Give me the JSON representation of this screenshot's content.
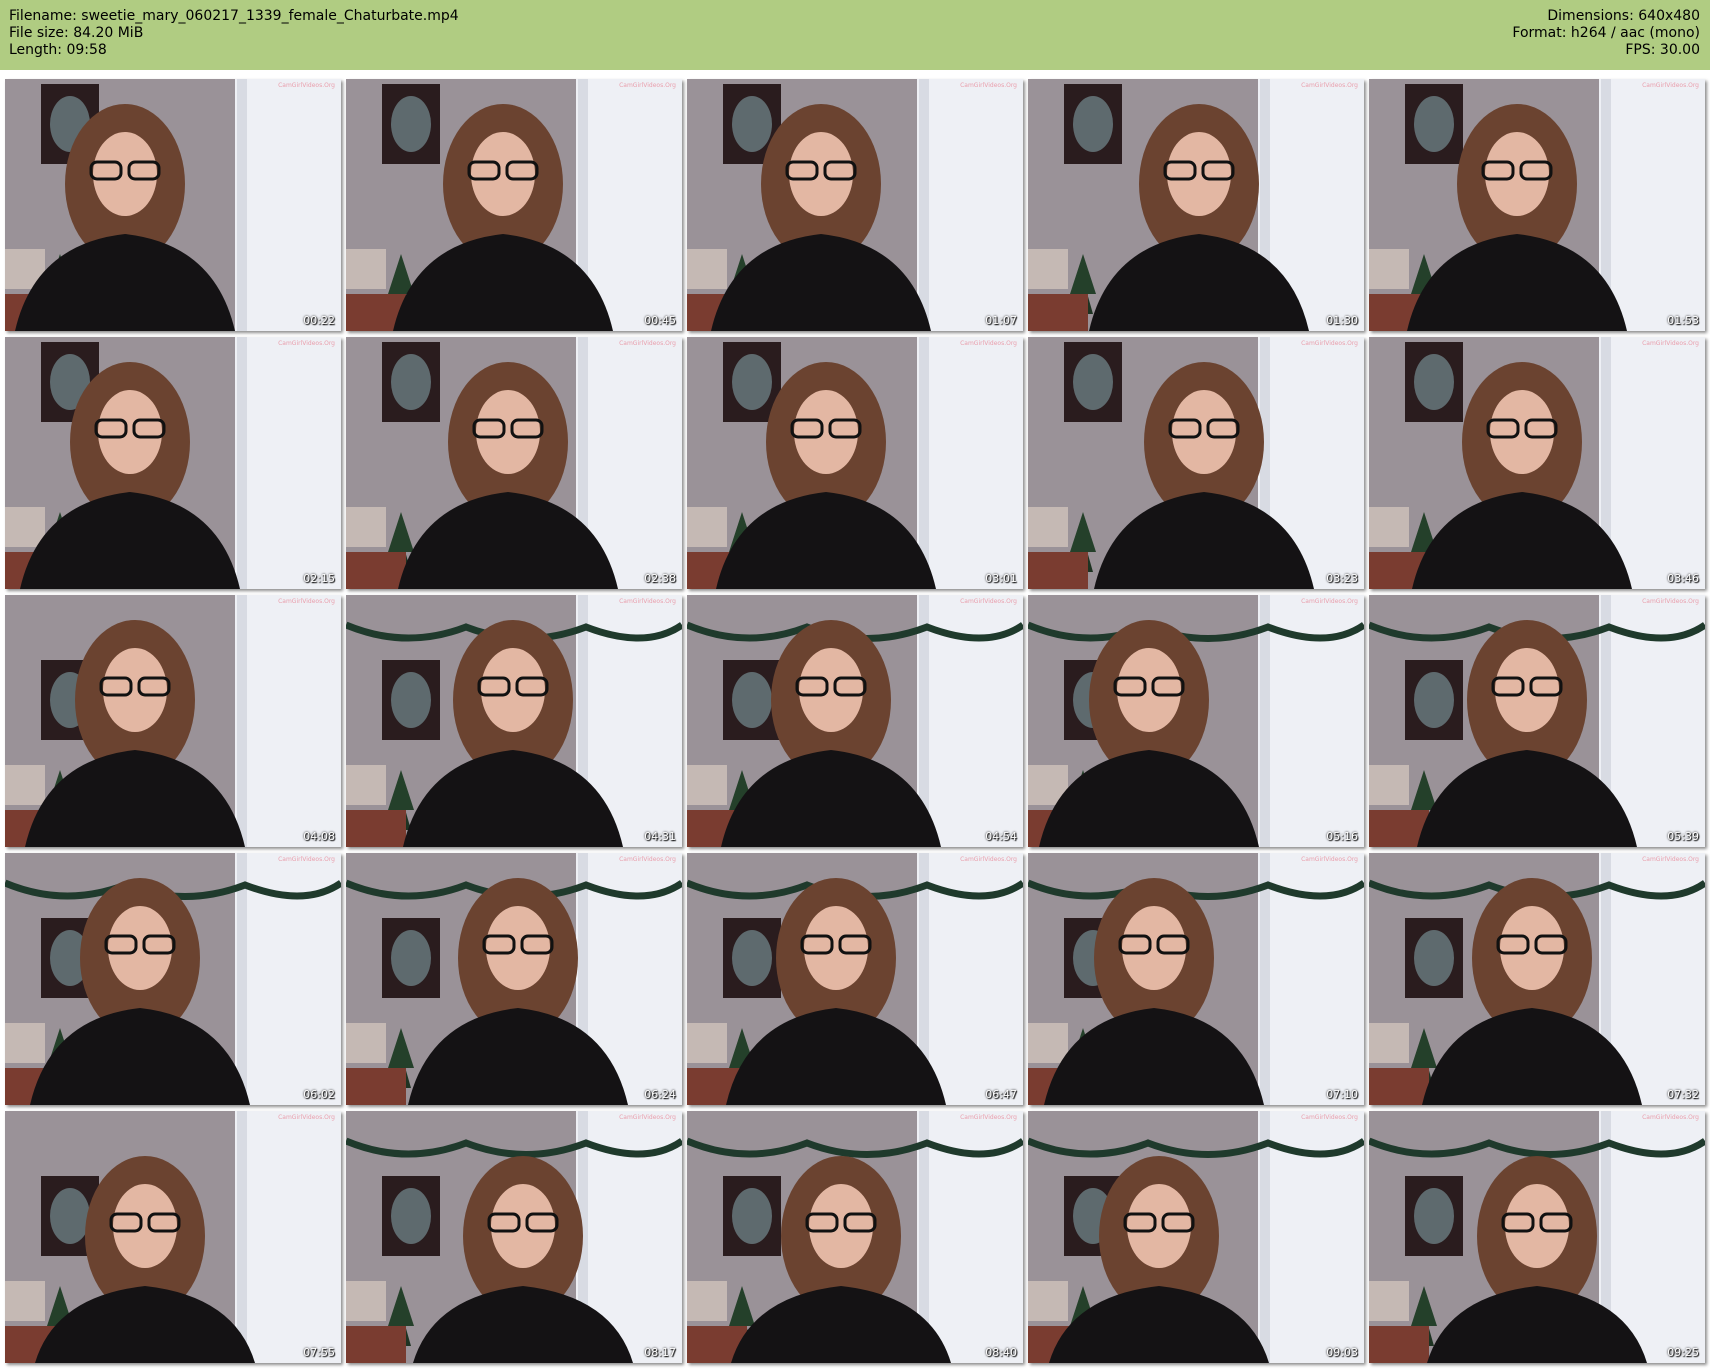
{
  "header": {
    "filename": "Filename: sweetie_mary_060217_1339_female_Chaturbate.mp4",
    "filesize": "File size: 84.20 MiB",
    "length": "Length: 09:58",
    "dimensions": "Dimensions: 640x480",
    "format": "Format: h264 / aac (mono)",
    "fps": "FPS: 30.00"
  },
  "thumbnails": [
    {
      "time": "00:22"
    },
    {
      "time": "00:45"
    },
    {
      "time": "01:07"
    },
    {
      "time": "01:30"
    },
    {
      "time": "01:53"
    },
    {
      "time": "02:15"
    },
    {
      "time": "02:38"
    },
    {
      "time": "03:01"
    },
    {
      "time": "03:23"
    },
    {
      "time": "03:46"
    },
    {
      "time": "04:08"
    },
    {
      "time": "04:31"
    },
    {
      "time": "04:54"
    },
    {
      "time": "05:16"
    },
    {
      "time": "05:39"
    },
    {
      "time": "06:02"
    },
    {
      "time": "06:24"
    },
    {
      "time": "06:47"
    },
    {
      "time": "07:10"
    },
    {
      "time": "07:32"
    },
    {
      "time": "07:55"
    },
    {
      "time": "08:17"
    },
    {
      "time": "08:40"
    },
    {
      "time": "09:03"
    },
    {
      "time": "09:25"
    }
  ],
  "colors": {
    "header_bg": "#b0cc82",
    "wallpaper": "#9a9298",
    "curtain": "#eef0f5",
    "hair": "#6b4330",
    "clothing": "#141214",
    "skin": "#e3b7a3"
  }
}
